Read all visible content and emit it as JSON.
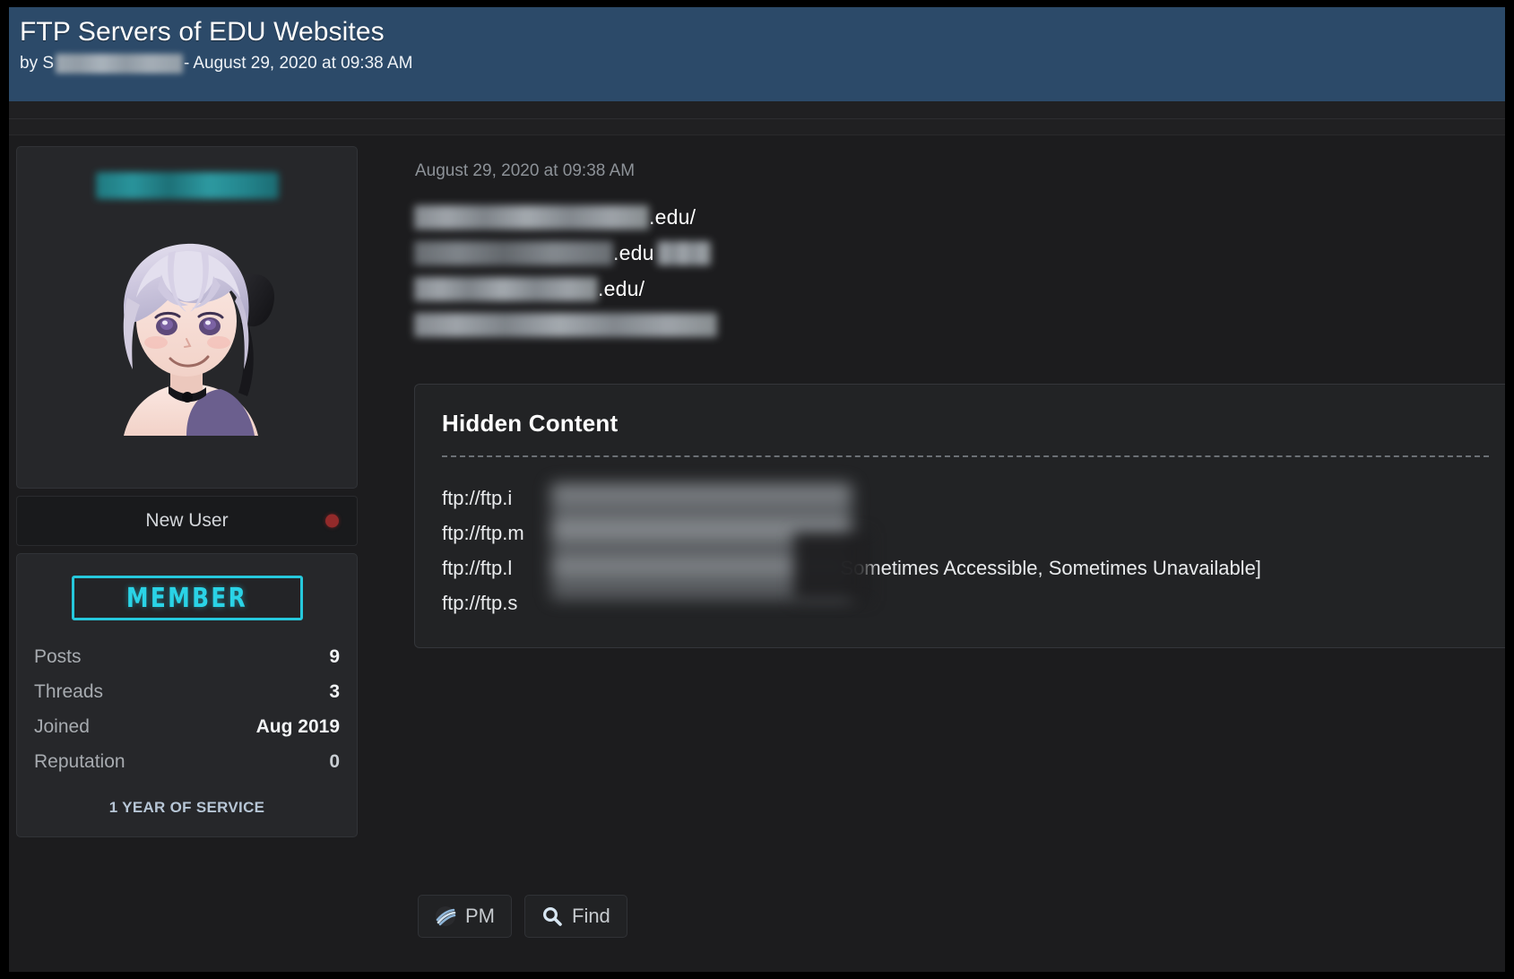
{
  "header": {
    "thread_title": "FTP Servers of EDU Websites",
    "byline_prefix": "by",
    "byline_author": "[redacted]",
    "byline_separator": "-",
    "byline_date": "August 29, 2020 at 09:38 AM"
  },
  "author": {
    "username": "[redacted]",
    "avatar_alt": "anime-girl-avatar",
    "user_title": "New User",
    "status": "offline",
    "status_color": "#932a2a",
    "rank_badge": "MEMBER",
    "rank_badge_color": "#2ad3e6",
    "stats": [
      {
        "label": "Posts",
        "value": "9"
      },
      {
        "label": "Threads",
        "value": "3"
      },
      {
        "label": "Joined",
        "value": "Aug 2019"
      },
      {
        "label": "Reputation",
        "value": "0"
      }
    ],
    "service_note": "1 YEAR OF SERVICE"
  },
  "post": {
    "date": "August 29, 2020 at 09:38 AM",
    "links": [
      {
        "redacted_width": 262,
        "tail": ".edu/"
      },
      {
        "redacted_width": 222,
        "tail": ".edu",
        "tail2_redacted_width": 60
      },
      {
        "redacted_width": 205,
        "tail": ".edu/"
      },
      {
        "redacted_width": 338,
        "tail": ""
      }
    ],
    "hidden_content": {
      "title": "Hidden Content",
      "lines": [
        {
          "prefix": "ftp://ftp.i",
          "note": ""
        },
        {
          "prefix": "ftp://ftp.m",
          "note": ""
        },
        {
          "prefix": "ftp://ftp.l",
          "note": "Sometimes Accessible, Sometimes Unavailable]"
        },
        {
          "prefix": "ftp://ftp.s",
          "note": ""
        }
      ]
    }
  },
  "actions": [
    {
      "name": "pm-button",
      "icon": "pm-icon",
      "label": "PM"
    },
    {
      "name": "find-button",
      "icon": "search-icon",
      "label": "Find"
    }
  ],
  "colors": {
    "header_blue": "#2c4a69",
    "page_bg": "#1c1c1e",
    "card_bg": "#26272a",
    "accent_cyan": "#2ad3e6",
    "offline_red": "#932a2a"
  }
}
